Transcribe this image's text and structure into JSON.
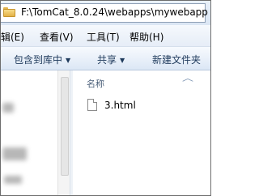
{
  "address_bar": {
    "path": "F:\\TomCat_8.0.24\\webapps\\mywebapp"
  },
  "menu": {
    "items": [
      {
        "label": "编辑(E)"
      },
      {
        "label": "查看(V)"
      },
      {
        "label": "工具(T)"
      },
      {
        "label": "帮助(H)"
      }
    ]
  },
  "command_bar": {
    "include_in_library": "包含到库中",
    "share": "共享",
    "new_folder": "新建文件夹"
  },
  "file_list": {
    "column_name": "名称",
    "files": [
      {
        "name": "3.html"
      }
    ]
  }
}
